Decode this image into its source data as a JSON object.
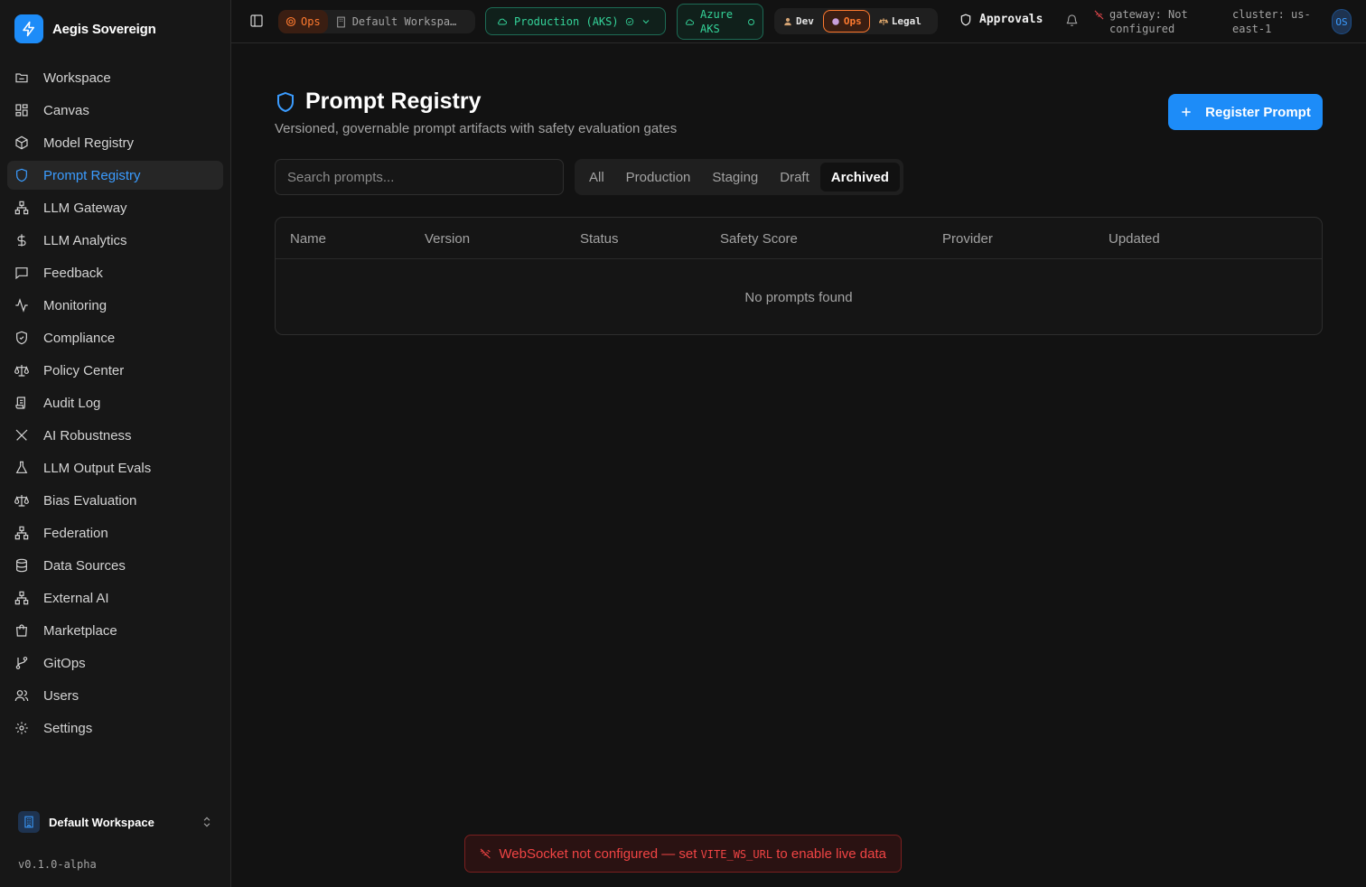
{
  "app": {
    "name": "Aegis Sovereign",
    "version": "v0.1.0-alpha"
  },
  "sidebar": {
    "items": [
      {
        "label": "Workspace",
        "icon": "folder-icon"
      },
      {
        "label": "Canvas",
        "icon": "grid-icon"
      },
      {
        "label": "Model Registry",
        "icon": "box-icon"
      },
      {
        "label": "Prompt Registry",
        "icon": "shield-icon",
        "active": true
      },
      {
        "label": "LLM Gateway",
        "icon": "network-icon"
      },
      {
        "label": "LLM Analytics",
        "icon": "dollar-icon"
      },
      {
        "label": "Feedback",
        "icon": "message-icon"
      },
      {
        "label": "Monitoring",
        "icon": "activity-icon"
      },
      {
        "label": "Compliance",
        "icon": "shield-check-icon"
      },
      {
        "label": "Policy Center",
        "icon": "scale-icon"
      },
      {
        "label": "Audit Log",
        "icon": "scroll-icon"
      },
      {
        "label": "AI Robustness",
        "icon": "swords-icon"
      },
      {
        "label": "LLM Output Evals",
        "icon": "flask-icon"
      },
      {
        "label": "Bias Evaluation",
        "icon": "scale-icon"
      },
      {
        "label": "Federation",
        "icon": "network-icon"
      },
      {
        "label": "Data Sources",
        "icon": "database-icon"
      },
      {
        "label": "External AI",
        "icon": "network-icon"
      },
      {
        "label": "Marketplace",
        "icon": "shopping-bag-icon"
      },
      {
        "label": "GitOps",
        "icon": "git-branch-icon"
      },
      {
        "label": "Users",
        "icon": "users-icon"
      },
      {
        "label": "Settings",
        "icon": "gear-icon"
      }
    ],
    "workspace": "Default Workspace"
  },
  "topbar": {
    "persona_badge": "Ops",
    "workspace": "Default Workspa…",
    "environment": "Production (AKS)",
    "cloud_line1": "Azure",
    "cloud_line2": "AKS",
    "personas": [
      "Dev",
      "Ops",
      "Legal"
    ],
    "active_persona": "Ops",
    "approvals": "Approvals",
    "gateway_line1": "gateway: Not",
    "gateway_line2": "configured",
    "cluster_line1": "cluster: us-",
    "cluster_line2": "east-1",
    "avatar": "OS"
  },
  "main": {
    "title": "Prompt Registry",
    "subtitle": "Versioned, governable prompt artifacts with safety evaluation gates",
    "register_label": "Register Prompt",
    "search_placeholder": "Search prompts...",
    "tabs": [
      "All",
      "Production",
      "Staging",
      "Draft",
      "Archived"
    ],
    "active_tab": "Archived",
    "columns": [
      "Name",
      "Version",
      "Status",
      "Safety Score",
      "Provider",
      "Updated"
    ],
    "empty_text": "No prompts found"
  },
  "toast": {
    "prefix": "WebSocket not configured — set ",
    "code": "VITE_WS_URL",
    "suffix": " to enable live data"
  },
  "colors": {
    "accent": "#1d8cf8",
    "ops": "#ff7a2f",
    "env": "#34d399",
    "error": "#f04444"
  }
}
